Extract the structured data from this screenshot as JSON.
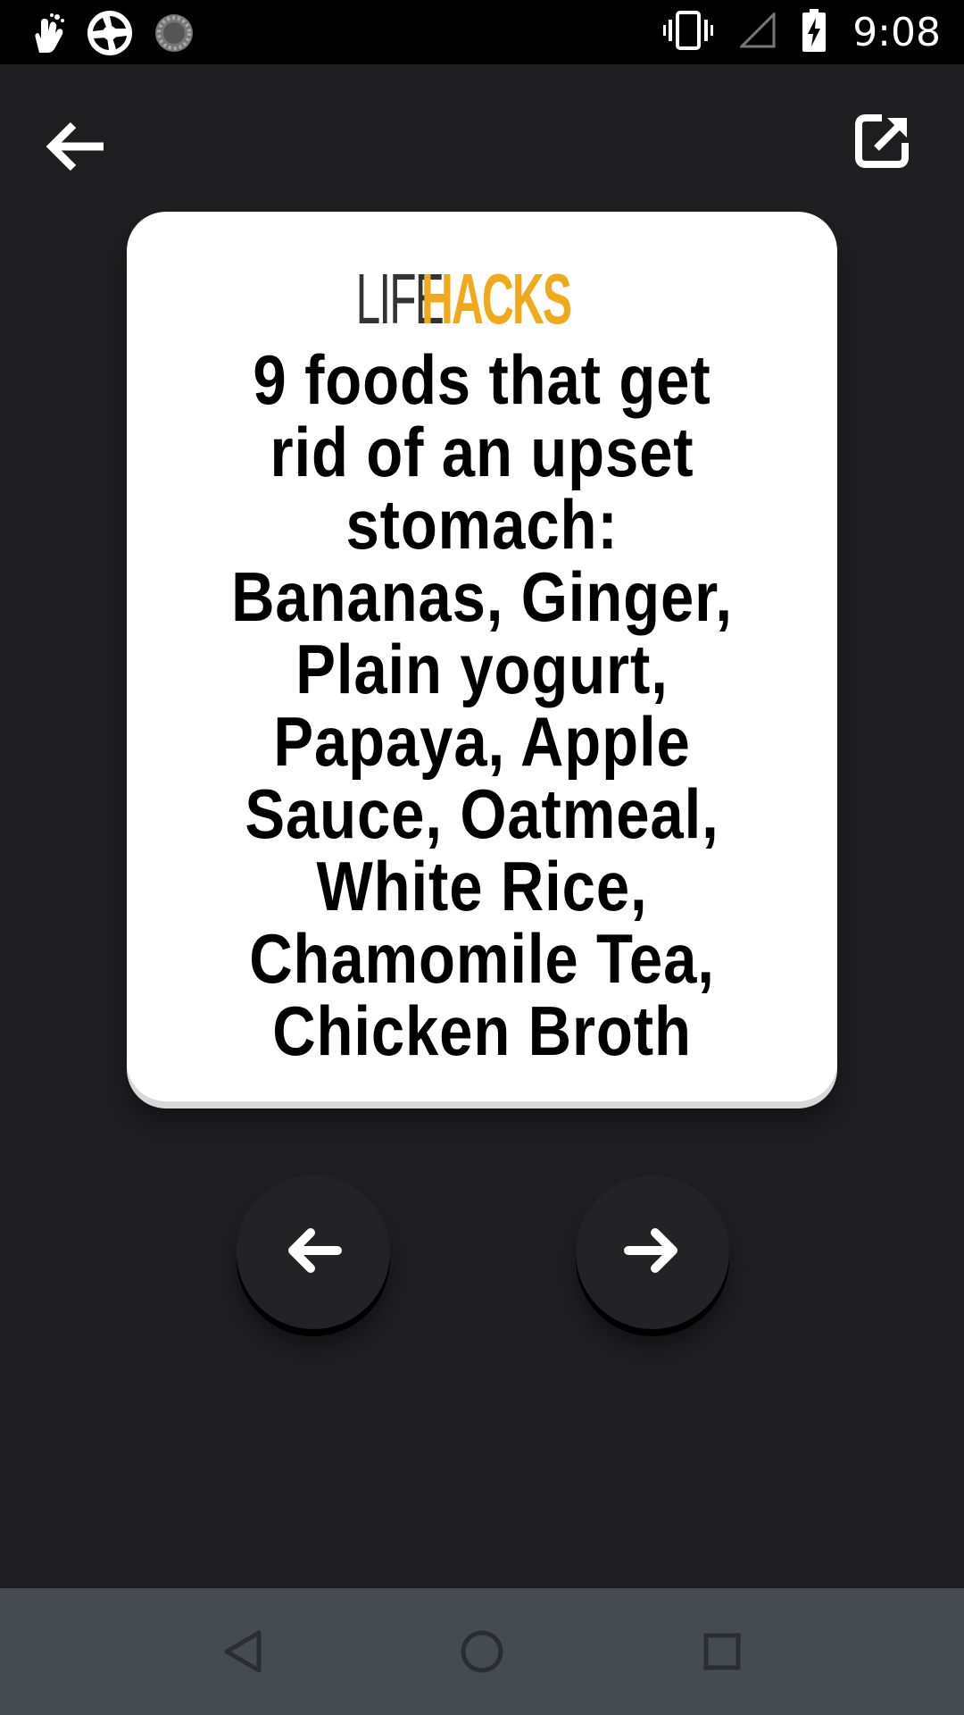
{
  "status_bar": {
    "time": "9:08",
    "left_icons": [
      "gesture-icon",
      "shutter-app-icon",
      "loading-spinner-icon"
    ],
    "right_icons": [
      "vibrate-icon",
      "signal-icon",
      "battery-charging-icon"
    ]
  },
  "top_bar": {
    "back_icon": "arrow-left-icon",
    "share_icon": "share-external-icon"
  },
  "card": {
    "brand_part1": "LIFE",
    "brand_part2": "HACKS",
    "fact": "9 foods that get rid of an upset stomach: Bananas, Ginger, Plain yogurt, Papaya, Apple Sauce, Oatmeal, White Rice, Chamomile Tea, Chicken Broth"
  },
  "colors": {
    "background": "#1e1e20",
    "card": "#ffffff",
    "accent": "#f0a91b",
    "nav_bar": "#464b51"
  },
  "navigation": {
    "prev_icon": "arrow-left-icon",
    "next_icon": "arrow-right-icon"
  },
  "system_nav": {
    "icons": [
      "nav-back-icon",
      "nav-home-icon",
      "nav-recents-icon"
    ]
  }
}
